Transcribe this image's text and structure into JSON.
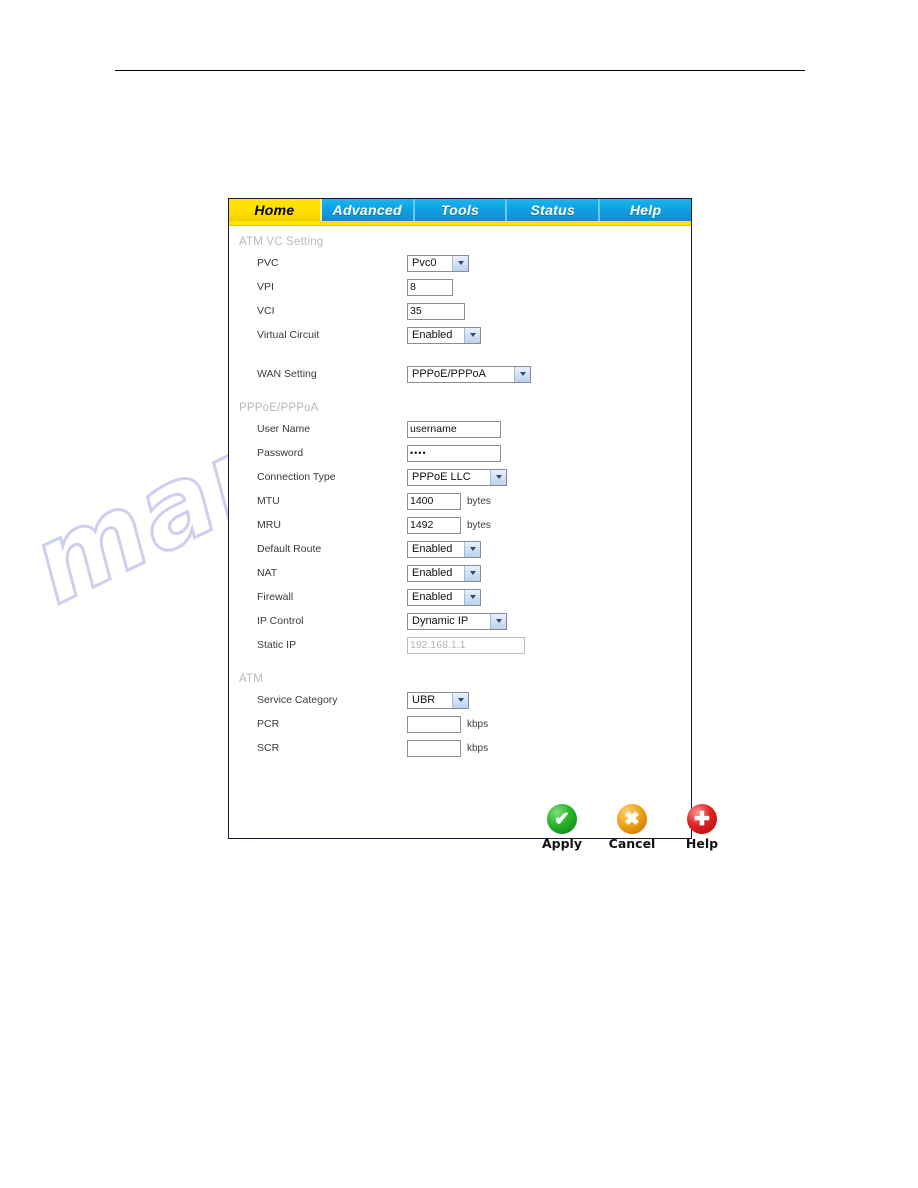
{
  "page": {
    "watermark": "manualslive.com"
  },
  "panel": {
    "tabs": [
      {
        "label": "Home",
        "active": true
      },
      {
        "label": "Advanced",
        "active": false
      },
      {
        "label": "Tools",
        "active": false
      },
      {
        "label": "Status",
        "active": false
      },
      {
        "label": "Help",
        "active": false
      }
    ],
    "colors": {
      "active_tab_bg": "#ffe500",
      "tab_bg": "#0fa4e4",
      "underline": "#ffe400",
      "section_title": "#b9b9b9",
      "apply": "#27b327",
      "cancel": "#f0a216",
      "help": "#e02424"
    },
    "sections": [
      {
        "title": "ATM VC Setting",
        "fields": [
          {
            "label": "PVC",
            "type": "select",
            "value": "Pvc0"
          },
          {
            "label": "VPI",
            "type": "text",
            "value": "8"
          },
          {
            "label": "VCI",
            "type": "text",
            "value": "35"
          },
          {
            "label": "Virtual Circuit",
            "type": "select",
            "value": "Enabled"
          },
          {
            "label": "WAN Setting",
            "type": "select",
            "value": "PPPoE/PPPoA"
          }
        ]
      },
      {
        "title": "PPPoE/PPPoA",
        "fields": [
          {
            "label": "User Name",
            "type": "text",
            "value": "username"
          },
          {
            "label": "Password",
            "type": "password",
            "value": "••••"
          },
          {
            "label": "Connection Type",
            "type": "select",
            "value": "PPPoE LLC"
          },
          {
            "label": "MTU",
            "type": "text",
            "value": "1400",
            "unit": "bytes"
          },
          {
            "label": "MRU",
            "type": "text",
            "value": "1492",
            "unit": "bytes"
          },
          {
            "label": "Default Route",
            "type": "select",
            "value": "Enabled"
          },
          {
            "label": "NAT",
            "type": "select",
            "value": "Enabled"
          },
          {
            "label": "Firewall",
            "type": "select",
            "value": "Enabled"
          },
          {
            "label": "IP Control",
            "type": "select",
            "value": "Dynamic IP"
          },
          {
            "label": "Static IP",
            "type": "text",
            "value": "192.168.1.1",
            "disabled": true
          }
        ]
      },
      {
        "title": "ATM",
        "fields": [
          {
            "label": "Service Category",
            "type": "select",
            "value": "UBR"
          },
          {
            "label": "PCR",
            "type": "text",
            "value": "",
            "unit": "kbps"
          },
          {
            "label": "SCR",
            "type": "text",
            "value": "",
            "unit": "kbps"
          }
        ]
      }
    ],
    "actions": [
      {
        "label": "Apply",
        "icon": "check-icon",
        "glyph": "✔"
      },
      {
        "label": "Cancel",
        "icon": "cross-icon",
        "glyph": "✖"
      },
      {
        "label": "Help",
        "icon": "plus-icon",
        "glyph": "✚"
      }
    ]
  }
}
